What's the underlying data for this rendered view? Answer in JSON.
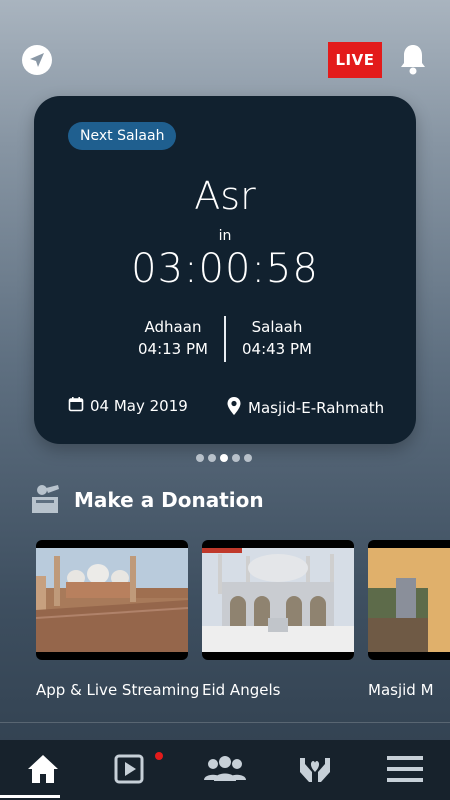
{
  "header": {
    "live_label": "LIVE"
  },
  "next_salaah": {
    "badge": "Next Salaah",
    "prayer": "Asr",
    "in_label": "in",
    "countdown": "03:00:58",
    "adhaan_label": "Adhaan",
    "adhaan_time": "04:13 PM",
    "salaah_label": "Salaah",
    "salaah_time": "04:43 PM",
    "date": "04 May 2019",
    "masjid": "Masjid-E-Rahmath"
  },
  "carousel": {
    "page_count": 5,
    "active_index": 2
  },
  "donation": {
    "title": "Make a Donation",
    "items": [
      {
        "label": "App & Live Streaming"
      },
      {
        "label": "Eid Angels"
      },
      {
        "label": "Masjid M"
      }
    ]
  },
  "nav": {
    "items": [
      "home-icon",
      "video-play-icon",
      "community-icon",
      "charity-hands-icon",
      "menu-icon"
    ],
    "active": "home-icon",
    "notification_on": "video-play-icon"
  },
  "colors": {
    "card_bg": "#11212f",
    "pill_bg": "#1f5f8f",
    "live_red": "#e31b1b",
    "nav_bg": "#17222c"
  }
}
